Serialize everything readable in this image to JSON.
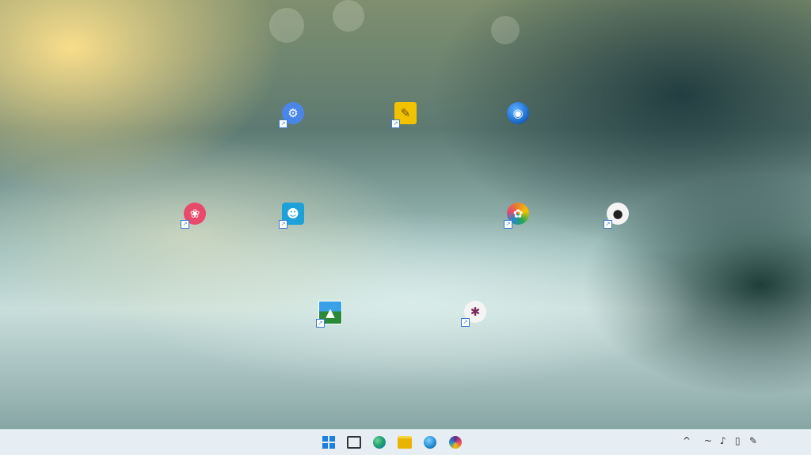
{
  "desktop": {
    "icons": [
      {
        "label": "",
        "icon": "settings-gear-icon",
        "color": "#4a86e8"
      },
      {
        "label": "",
        "icon": "sticky-notes-icon",
        "color": "#f2c200"
      },
      {
        "label": "",
        "icon": "globe-browser-icon",
        "color": "#1f6fd1"
      },
      {
        "label": "",
        "icon": "red-circular-app-icon",
        "color": "#e84a6a"
      },
      {
        "label": "",
        "icon": "people-app-icon",
        "color": "#1ea0d8"
      },
      {
        "label": "",
        "icon": "colorful-app-icon",
        "color": "#e8862a"
      },
      {
        "label": "",
        "icon": "dark-circular-app-icon",
        "color": "#222222"
      },
      {
        "label": "",
        "icon": "photo-app-icon",
        "color": "#2a8a3a"
      },
      {
        "label": "",
        "icon": "purple-circular-app-icon",
        "color": "#7a2a5a"
      }
    ]
  },
  "taskbar": {
    "apps": [
      {
        "icon": "start-menu-icon",
        "color": "#1d7fe0"
      },
      {
        "icon": "task-view-icon",
        "color": "#333333"
      },
      {
        "icon": "edge-browser-icon",
        "color": "#1aa06a"
      },
      {
        "icon": "file-explorer-icon",
        "color": "#e8b400"
      },
      {
        "icon": "globe-browser-icon",
        "color": "#1f8ad1"
      },
      {
        "icon": "media-app-icon",
        "color": "#6a2a8a"
      }
    ],
    "tray": [
      {
        "icon": "chevron-up-icon",
        "glyph": "^"
      },
      {
        "icon": "network-icon",
        "glyph": "~"
      },
      {
        "icon": "volume-icon",
        "glyph": "♪"
      },
      {
        "icon": "battery-icon",
        "glyph": "▯"
      },
      {
        "icon": "pen-icon",
        "glyph": "✎"
      }
    ],
    "clock": {
      "time": "",
      "date": ""
    }
  }
}
